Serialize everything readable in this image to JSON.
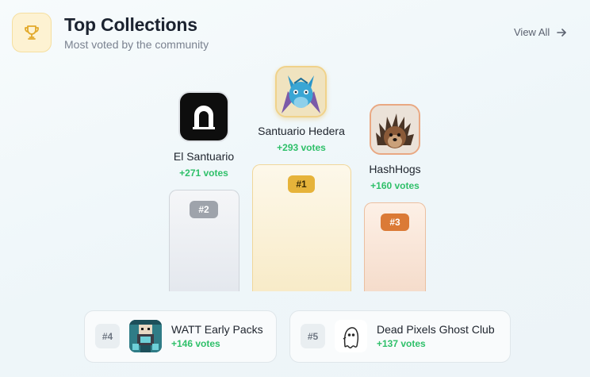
{
  "header": {
    "title": "Top Collections",
    "subtitle": "Most voted by the community",
    "icon": "trophy-icon",
    "view_all_label": "View All"
  },
  "podium": [
    {
      "rank": "#2",
      "name": "El Santuario",
      "votes": "+271 votes",
      "avatar_icon": "sanctuary-arch-icon",
      "color": "#9ea3ab"
    },
    {
      "rank": "#1",
      "name": "Santuario Hedera",
      "votes": "+293 votes",
      "avatar_icon": "dragon-avatar",
      "color": "#e6b33a"
    },
    {
      "rank": "#3",
      "name": "HashHogs",
      "votes": "+160 votes",
      "avatar_icon": "hedgehog-avatar",
      "color": "#db7a36"
    }
  ],
  "list": [
    {
      "rank": "#4",
      "name": "WATT Early Packs",
      "votes": "+146 votes",
      "thumb_icon": "pixel-robot-thumb"
    },
    {
      "rank": "#5",
      "name": "Dead Pixels Ghost Club",
      "votes": "+137 votes",
      "thumb_icon": "ghost-icon"
    }
  ],
  "colors": {
    "vote_green": "#2fc06a",
    "gold": "#e6b33a",
    "silver": "#9ea3ab",
    "bronze": "#db7a36"
  }
}
